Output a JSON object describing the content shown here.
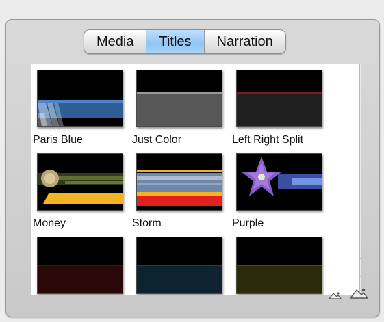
{
  "tabs": [
    {
      "label": "Media",
      "selected": false
    },
    {
      "label": "Titles",
      "selected": true
    },
    {
      "label": "Narration",
      "selected": false
    }
  ],
  "titles": [
    {
      "label": "Paris Blue",
      "thumbnail": "paris-blue"
    },
    {
      "label": "Just Color",
      "thumbnail": "just-color"
    },
    {
      "label": "Left Right Split",
      "thumbnail": "left-right-split"
    },
    {
      "label": "Money",
      "thumbnail": "money"
    },
    {
      "label": "Storm",
      "thumbnail": "storm"
    },
    {
      "label": "Purple",
      "thumbnail": "purple"
    },
    {
      "label": "",
      "thumbnail": "dark-red"
    },
    {
      "label": "",
      "thumbnail": "dark-teal"
    },
    {
      "label": "",
      "thumbnail": "dark-olive"
    }
  ],
  "zoom": {
    "small_icon": "zoom-small-icon",
    "large_icon": "zoom-large-icon"
  },
  "colors": {
    "selected_tab": "#9fcdf5",
    "scroll_thumb": "#4b8fda",
    "selection_accent": "#3c74b8"
  }
}
